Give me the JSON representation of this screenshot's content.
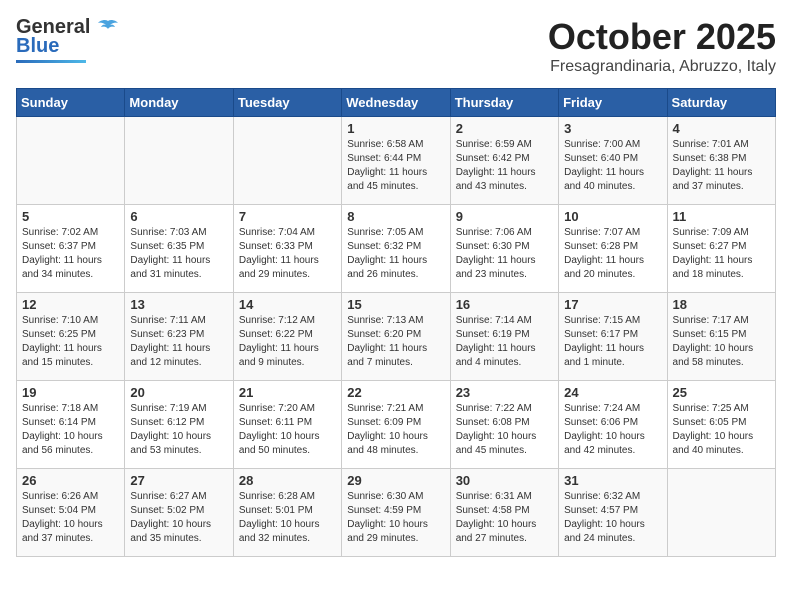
{
  "header": {
    "logo_general": "General",
    "logo_blue": "Blue",
    "month_title": "October 2025",
    "location": "Fresagrandinaria, Abruzzo, Italy"
  },
  "days_of_week": [
    "Sunday",
    "Monday",
    "Tuesday",
    "Wednesday",
    "Thursday",
    "Friday",
    "Saturday"
  ],
  "weeks": [
    [
      {
        "day": "",
        "info": ""
      },
      {
        "day": "",
        "info": ""
      },
      {
        "day": "",
        "info": ""
      },
      {
        "day": "1",
        "info": "Sunrise: 6:58 AM\nSunset: 6:44 PM\nDaylight: 11 hours\nand 45 minutes."
      },
      {
        "day": "2",
        "info": "Sunrise: 6:59 AM\nSunset: 6:42 PM\nDaylight: 11 hours\nand 43 minutes."
      },
      {
        "day": "3",
        "info": "Sunrise: 7:00 AM\nSunset: 6:40 PM\nDaylight: 11 hours\nand 40 minutes."
      },
      {
        "day": "4",
        "info": "Sunrise: 7:01 AM\nSunset: 6:38 PM\nDaylight: 11 hours\nand 37 minutes."
      }
    ],
    [
      {
        "day": "5",
        "info": "Sunrise: 7:02 AM\nSunset: 6:37 PM\nDaylight: 11 hours\nand 34 minutes."
      },
      {
        "day": "6",
        "info": "Sunrise: 7:03 AM\nSunset: 6:35 PM\nDaylight: 11 hours\nand 31 minutes."
      },
      {
        "day": "7",
        "info": "Sunrise: 7:04 AM\nSunset: 6:33 PM\nDaylight: 11 hours\nand 29 minutes."
      },
      {
        "day": "8",
        "info": "Sunrise: 7:05 AM\nSunset: 6:32 PM\nDaylight: 11 hours\nand 26 minutes."
      },
      {
        "day": "9",
        "info": "Sunrise: 7:06 AM\nSunset: 6:30 PM\nDaylight: 11 hours\nand 23 minutes."
      },
      {
        "day": "10",
        "info": "Sunrise: 7:07 AM\nSunset: 6:28 PM\nDaylight: 11 hours\nand 20 minutes."
      },
      {
        "day": "11",
        "info": "Sunrise: 7:09 AM\nSunset: 6:27 PM\nDaylight: 11 hours\nand 18 minutes."
      }
    ],
    [
      {
        "day": "12",
        "info": "Sunrise: 7:10 AM\nSunset: 6:25 PM\nDaylight: 11 hours\nand 15 minutes."
      },
      {
        "day": "13",
        "info": "Sunrise: 7:11 AM\nSunset: 6:23 PM\nDaylight: 11 hours\nand 12 minutes."
      },
      {
        "day": "14",
        "info": "Sunrise: 7:12 AM\nSunset: 6:22 PM\nDaylight: 11 hours\nand 9 minutes."
      },
      {
        "day": "15",
        "info": "Sunrise: 7:13 AM\nSunset: 6:20 PM\nDaylight: 11 hours\nand 7 minutes."
      },
      {
        "day": "16",
        "info": "Sunrise: 7:14 AM\nSunset: 6:19 PM\nDaylight: 11 hours\nand 4 minutes."
      },
      {
        "day": "17",
        "info": "Sunrise: 7:15 AM\nSunset: 6:17 PM\nDaylight: 11 hours\nand 1 minute."
      },
      {
        "day": "18",
        "info": "Sunrise: 7:17 AM\nSunset: 6:15 PM\nDaylight: 10 hours\nand 58 minutes."
      }
    ],
    [
      {
        "day": "19",
        "info": "Sunrise: 7:18 AM\nSunset: 6:14 PM\nDaylight: 10 hours\nand 56 minutes."
      },
      {
        "day": "20",
        "info": "Sunrise: 7:19 AM\nSunset: 6:12 PM\nDaylight: 10 hours\nand 53 minutes."
      },
      {
        "day": "21",
        "info": "Sunrise: 7:20 AM\nSunset: 6:11 PM\nDaylight: 10 hours\nand 50 minutes."
      },
      {
        "day": "22",
        "info": "Sunrise: 7:21 AM\nSunset: 6:09 PM\nDaylight: 10 hours\nand 48 minutes."
      },
      {
        "day": "23",
        "info": "Sunrise: 7:22 AM\nSunset: 6:08 PM\nDaylight: 10 hours\nand 45 minutes."
      },
      {
        "day": "24",
        "info": "Sunrise: 7:24 AM\nSunset: 6:06 PM\nDaylight: 10 hours\nand 42 minutes."
      },
      {
        "day": "25",
        "info": "Sunrise: 7:25 AM\nSunset: 6:05 PM\nDaylight: 10 hours\nand 40 minutes."
      }
    ],
    [
      {
        "day": "26",
        "info": "Sunrise: 6:26 AM\nSunset: 5:04 PM\nDaylight: 10 hours\nand 37 minutes."
      },
      {
        "day": "27",
        "info": "Sunrise: 6:27 AM\nSunset: 5:02 PM\nDaylight: 10 hours\nand 35 minutes."
      },
      {
        "day": "28",
        "info": "Sunrise: 6:28 AM\nSunset: 5:01 PM\nDaylight: 10 hours\nand 32 minutes."
      },
      {
        "day": "29",
        "info": "Sunrise: 6:30 AM\nSunset: 4:59 PM\nDaylight: 10 hours\nand 29 minutes."
      },
      {
        "day": "30",
        "info": "Sunrise: 6:31 AM\nSunset: 4:58 PM\nDaylight: 10 hours\nand 27 minutes."
      },
      {
        "day": "31",
        "info": "Sunrise: 6:32 AM\nSunset: 4:57 PM\nDaylight: 10 hours\nand 24 minutes."
      },
      {
        "day": "",
        "info": ""
      }
    ]
  ]
}
